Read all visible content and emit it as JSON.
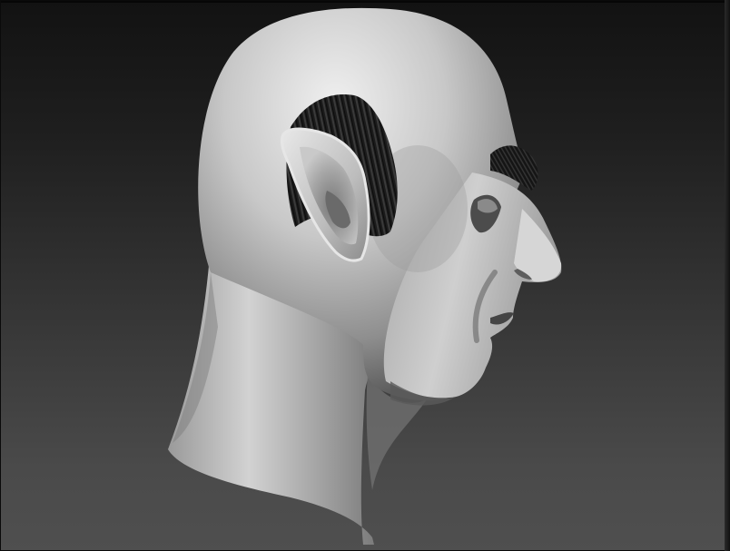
{
  "scene": {
    "kind": "3d-sculpt-viewport",
    "subject": "bald-head-pointed-ear-profile",
    "colors": {
      "background_top": "#121212",
      "background_bottom": "#4f4f4f",
      "clay_light": "#e6e6e6",
      "clay_mid": "#a9a9a9",
      "clay_shadow": "#5a5a5a",
      "hair": "#1a1a1a"
    }
  }
}
